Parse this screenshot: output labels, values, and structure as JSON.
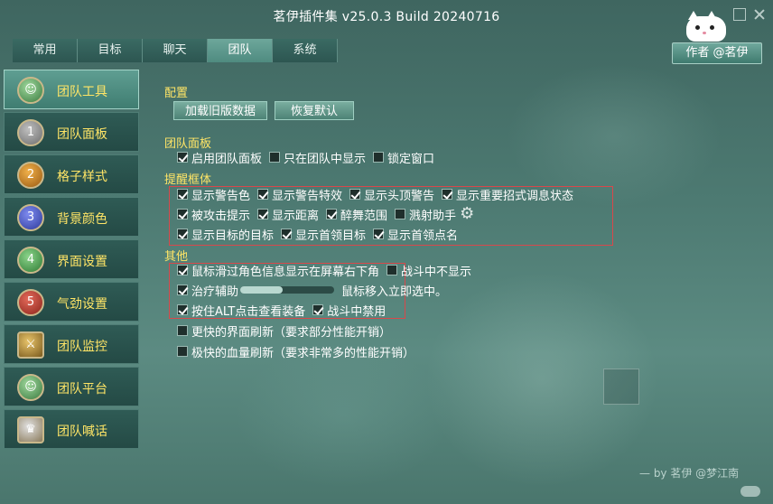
{
  "window": {
    "title": "茗伊插件集 v25.0.3 Build 20240716"
  },
  "tabs": [
    {
      "label": "常用"
    },
    {
      "label": "目标"
    },
    {
      "label": "聊天"
    },
    {
      "label": "团队",
      "active": true
    },
    {
      "label": "系统"
    }
  ],
  "author_button": "作者 @茗伊",
  "sidebar": {
    "items": [
      {
        "label": "团队工具",
        "icon": "people-icon",
        "active": true
      },
      {
        "label": "团队面板",
        "icon": "number-1-icon",
        "badge": "1"
      },
      {
        "label": "格子样式",
        "icon": "number-2-icon",
        "badge": "2"
      },
      {
        "label": "背景颜色",
        "icon": "number-3-icon",
        "badge": "3"
      },
      {
        "label": "界面设置",
        "icon": "number-4-icon",
        "badge": "4"
      },
      {
        "label": "气劲设置",
        "icon": "number-5-icon",
        "badge": "5"
      },
      {
        "label": "团队监控",
        "icon": "sword-icon"
      },
      {
        "label": "团队平台",
        "icon": "people-icon"
      },
      {
        "label": "团队喊话",
        "icon": "hat-icon"
      }
    ]
  },
  "config": {
    "title": "配置",
    "load_old_btn": "加载旧版数据",
    "restore_default_btn": "恢复默认"
  },
  "team_panel": {
    "title": "团队面板",
    "options": [
      {
        "label": "启用团队面板",
        "checked": true
      },
      {
        "label": "只在团队中显示",
        "checked": false
      },
      {
        "label": "锁定窗口",
        "checked": false
      }
    ]
  },
  "alert_frame": {
    "title": "提醒框体",
    "row1": [
      {
        "label": "显示警告色",
        "checked": true
      },
      {
        "label": "显示警告特效",
        "checked": true
      },
      {
        "label": "显示头顶警告",
        "checked": true
      },
      {
        "label": "显示重要招式调息状态",
        "checked": true
      }
    ],
    "row2": [
      {
        "label": "被攻击提示",
        "checked": true
      },
      {
        "label": "显示距离",
        "checked": true
      },
      {
        "label": "醉舞范围",
        "checked": true
      },
      {
        "label": "溅射助手",
        "checked": false
      }
    ],
    "row3": [
      {
        "label": "显示目标的目标",
        "checked": true
      },
      {
        "label": "显示首领目标",
        "checked": true
      },
      {
        "label": "显示首领点名",
        "checked": true
      }
    ]
  },
  "other": {
    "title": "其他",
    "mouse_over": {
      "label": "鼠标滑过角色信息显示在屏幕右下角",
      "checked": true
    },
    "no_combat_show": {
      "label": "战斗中不显示",
      "checked": false
    },
    "heal_assist": {
      "label": "治疗辅助",
      "checked": true
    },
    "heal_slider": {
      "value": 0.45,
      "label": "鼠标移入立即选中。"
    },
    "alt_click": {
      "label": "按住ALT点击查看装备",
      "checked": true
    },
    "combat_disable": {
      "label": "战斗中禁用",
      "checked": true
    },
    "faster_ui": {
      "label": "更快的界面刷新（要求部分性能开销）",
      "checked": false
    },
    "fastest_hp": {
      "label": "极快的血量刷新（要求非常多的性能开销）",
      "checked": false
    }
  },
  "footer": "— by 茗伊 @梦江南",
  "colors": {
    "accent_yellow": "#ffe566",
    "active_tab": "#5f9e92",
    "highlight_red": "#d9484b"
  }
}
